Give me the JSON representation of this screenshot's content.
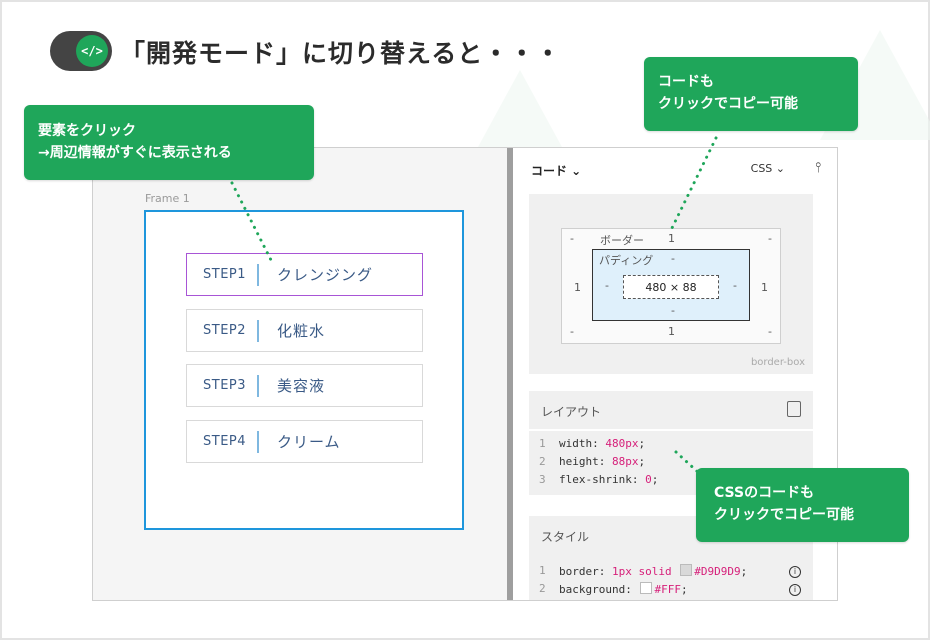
{
  "header": {
    "toggle_icon": "</>",
    "title": "「開発モード」に切り替えると・・・"
  },
  "canvas": {
    "frame_label": "Frame 1",
    "steps": [
      {
        "num": "STEP1",
        "name": "クレンジング"
      },
      {
        "num": "STEP2",
        "name": "化粧水"
      },
      {
        "num": "STEP3",
        "name": "美容液"
      },
      {
        "num": "STEP4",
        "name": "クリーム"
      }
    ]
  },
  "inspector": {
    "code_dropdown": "コード ⌄",
    "css_dropdown": "CSS ⌄",
    "tune_icon": "⫯",
    "box_model": {
      "border_label": "ボーダー",
      "padding_label": "パディング",
      "border_top": "1",
      "border_bottom": "1",
      "border_left": "1",
      "border_right": "1",
      "margin_dash": "-",
      "content_size": "480 × 88",
      "footer": "border-box"
    },
    "layout": {
      "title": "レイアウト",
      "lines": [
        {
          "n": "1",
          "prop": "width: ",
          "val": "480px",
          "end": ";"
        },
        {
          "n": "2",
          "prop": "height: ",
          "val": "88px",
          "end": ";"
        },
        {
          "n": "3",
          "prop": "flex-shrink: ",
          "val": "0",
          "end": ";"
        }
      ]
    },
    "style": {
      "title": "スタイル",
      "lines": [
        {
          "n": "1",
          "prop": "border: ",
          "val": "1px solid ",
          "color": "#D9D9D9",
          "end": ";"
        },
        {
          "n": "2",
          "prop": "background: ",
          "val": "",
          "color": "#FFF",
          "end": ";"
        }
      ]
    }
  },
  "callouts": {
    "element": {
      "line1": "要素をクリック",
      "line2": "→周辺情報がすぐに表示される"
    },
    "code": {
      "line1": "コードも",
      "line2": "クリックでコピー可能"
    },
    "css": {
      "line1": "CSSのコードも",
      "line2": "クリックでコピー可能"
    }
  },
  "colors": {
    "accent_green": "#1fa65a",
    "frame_blue": "#1e96dc",
    "selection_purple": "#a855d6",
    "code_value_pink": "#d6207a"
  }
}
